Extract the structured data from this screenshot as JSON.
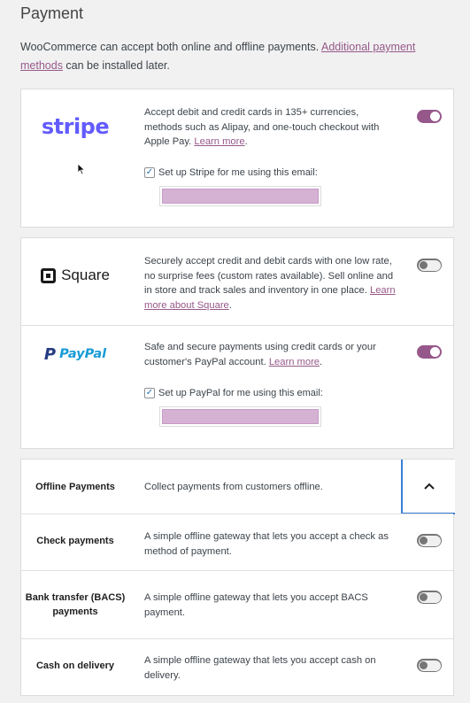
{
  "page": {
    "title": "Payment",
    "intro_text": "WooCommerce can accept both online and offline payments. ",
    "intro_link": "Additional payment methods",
    "intro_suffix": " can be installed later."
  },
  "colors": {
    "accent": "#96588a",
    "toggle_off": "#757575",
    "email_redaction": "#d5b2d4",
    "focus_outline": "#3c7fd6"
  },
  "stripe": {
    "logo_text": "stripe",
    "description": "Accept debit and credit cards in 135+ currencies, methods such as Alipay, and one-touch checkout with Apple Pay. ",
    "learn_more": "Learn more",
    "checkbox_label": "Set up Stripe for me using this email:",
    "checkbox_checked": true,
    "enabled": true
  },
  "square": {
    "logo_text": "Square",
    "description": "Securely accept credit and debit cards with one low rate, no surprise fees (custom rates available). Sell online and in store and track sales and inventory in one place. ",
    "learn_more": "Learn more about Square",
    "enabled": false
  },
  "paypal": {
    "logo_text": "PayPal",
    "description": "Safe and secure payments using credit cards or your customer's PayPal account. ",
    "learn_more": "Learn more",
    "checkbox_label": "Set up PayPal for me using this email:",
    "checkbox_checked": true,
    "enabled": true
  },
  "offline": {
    "label": "Offline Payments",
    "description": "Collect payments from customers offline.",
    "chevron_icon": "chevron-up-icon",
    "gateways": [
      {
        "label": "Check payments",
        "description": "A simple offline gateway that lets you accept a check as method of payment.",
        "enabled": false
      },
      {
        "label": "Bank transfer (BACS) payments",
        "description": "A simple offline gateway that lets you accept BACS payment.",
        "enabled": false
      },
      {
        "label": "Cash on delivery",
        "description": "A simple offline gateway that lets you accept cash on delivery.",
        "enabled": false
      }
    ]
  }
}
